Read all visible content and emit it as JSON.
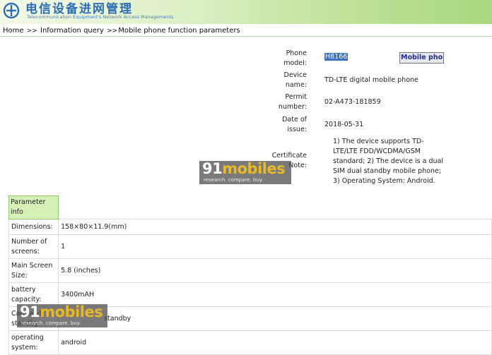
{
  "header": {
    "title": "电信设备进网管理",
    "subtitle": "Telecommunication Equipment's Network Access Managements"
  },
  "breadcrumb": {
    "items": [
      "Home",
      "Information query",
      "Mobile phone function parameters"
    ],
    "separator": ">>"
  },
  "device": {
    "phone_model_label": "Phone model:",
    "phone_model_value": "H8166",
    "mobile_button_label": "Mobile phon",
    "device_name_label": "Device name:",
    "device_name_value": "TD-LTE digital mobile phone",
    "permit_label": "Permit number:",
    "permit_value": "02-A473-181859",
    "issue_label": "Date of issue:",
    "issue_value": "2018-05-31",
    "note_label": "Certificate Note:",
    "note_value": "1) The device supports TD-LTE/LTE FDD/WCDMA/GSM standard; 2) The device is a dual SIM dual standby mobile phone; 3) Operating System: Android."
  },
  "params": {
    "header": "Parameter info",
    "rows": [
      {
        "name": "Dimensions:",
        "value": "158×80×11.9(mm)"
      },
      {
        "name": "Number of screens:",
        "value": "1"
      },
      {
        "name": "Main Screen Size:",
        "value": "5.8 (inches)"
      },
      {
        "name": "battery capacity:",
        "value": "3400mAH"
      },
      {
        "name": "Card and standby",
        "value": "standby"
      },
      {
        "name": "operating system:",
        "value": "android"
      }
    ]
  },
  "watermark": {
    "brand_num": "91",
    "brand_text": "mobiles",
    "tagline": "research. compare. buy."
  },
  "colors": {
    "accent_blue": "#2c6db5",
    "header_green": "#d6f0b8",
    "watermark_orange": "#e8b825"
  }
}
